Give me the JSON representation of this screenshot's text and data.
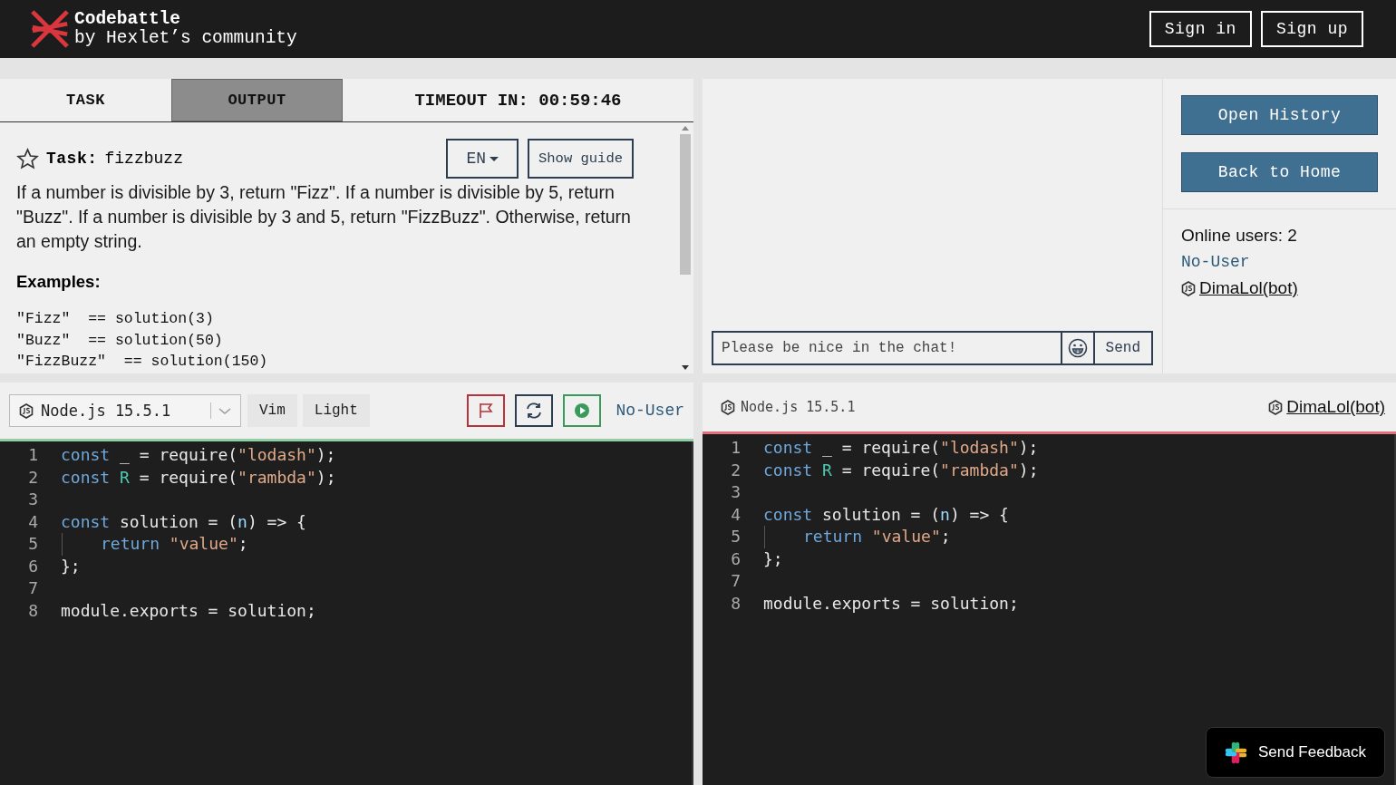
{
  "header": {
    "logo_title": "Codebattle",
    "logo_subtitle": "by Hexlet’s community",
    "buttons": [
      "Sign in",
      "Sign up"
    ]
  },
  "task_panel": {
    "tabs": [
      {
        "label": "TASK",
        "selected": true
      },
      {
        "label": "OUTPUT",
        "selected": false
      }
    ],
    "timeout": "TIMEOUT IN: 00:59:46",
    "starred": false,
    "task_label": "Task:",
    "task_name": "fizzbuzz",
    "language": "EN",
    "guide_button": "Show guide",
    "description": "If a number is divisible by 3, return \"Fizz\". If a number is divisible by 5, return \"Buzz\". If a number is divisible by 3 and 5, return \"FizzBuzz\". Otherwise, return an empty string.",
    "examples_heading": "Examples:",
    "examples": [
      "\"Fizz\"  == solution(3)",
      "\"Buzz\"  == solution(50)",
      "\"FizzBuzz\"  == solution(150)"
    ]
  },
  "chat": {
    "placeholder": "Please be nice in the chat!",
    "send": "Send"
  },
  "sidebar": {
    "buttons": [
      "Open History",
      "Back to Home"
    ],
    "online_users": "Online users: 2",
    "users": [
      {
        "name": "No-User",
        "kind": "user"
      },
      {
        "name": "DimaLol(bot)",
        "kind": "bot"
      }
    ]
  },
  "editors": [
    {
      "language": "Node.js 15.5.1",
      "kind": "own",
      "buttons": [
        "Vim",
        "Light"
      ],
      "player": "No-User",
      "color": "#8fd1a5",
      "lines": [
        {
          "number": "1",
          "tokens": [
            {
              "kind": "keyword",
              "text": "const "
            },
            {
              "kind": "plain",
              "text": "_ = require("
            },
            {
              "kind": "string",
              "text": "\"lodash\""
            },
            {
              "kind": "plain",
              "text": ");"
            }
          ]
        },
        {
          "number": "2",
          "tokens": [
            {
              "kind": "keyword",
              "text": "const "
            },
            {
              "kind": "var",
              "text": "R"
            },
            {
              "kind": "plain",
              "text": " = require("
            },
            {
              "kind": "string",
              "text": "\"rambda\""
            },
            {
              "kind": "plain",
              "text": ");"
            }
          ]
        },
        {
          "number": "3"
        },
        {
          "number": "4",
          "tokens": [
            {
              "kind": "keyword",
              "text": "const "
            },
            {
              "kind": "plain",
              "text": "solution = ("
            },
            {
              "kind": "param",
              "text": "n"
            },
            {
              "kind": "plain",
              "text": ") => {"
            }
          ]
        },
        {
          "number": "5",
          "indented": true,
          "tokens": [
            {
              "kind": "keyword",
              "text": "return "
            },
            {
              "kind": "string",
              "text": "\"value\""
            },
            {
              "kind": "plain",
              "text": ";"
            }
          ]
        },
        {
          "number": "6",
          "tokens": [
            {
              "kind": "plain",
              "text": "};"
            }
          ]
        },
        {
          "number": "7"
        },
        {
          "number": "8",
          "tokens": [
            {
              "kind": "plain",
              "text": "module.exports = solution;"
            }
          ]
        }
      ]
    },
    {
      "language": "Node.js 15.5.1",
      "kind": "opponent",
      "player": "DimaLol(bot)",
      "color": "#e0707a",
      "lines": [
        {
          "number": "1",
          "tokens": [
            {
              "kind": "keyword",
              "text": "const "
            },
            {
              "kind": "plain",
              "text": "_ = require("
            },
            {
              "kind": "string",
              "text": "\"lodash\""
            },
            {
              "kind": "plain",
              "text": ");"
            }
          ]
        },
        {
          "number": "2",
          "tokens": [
            {
              "kind": "keyword",
              "text": "const "
            },
            {
              "kind": "var",
              "text": "R"
            },
            {
              "kind": "plain",
              "text": " = require("
            },
            {
              "kind": "string",
              "text": "\"rambda\""
            },
            {
              "kind": "plain",
              "text": ");"
            }
          ]
        },
        {
          "number": "3"
        },
        {
          "number": "4",
          "tokens": [
            {
              "kind": "keyword",
              "text": "const "
            },
            {
              "kind": "plain",
              "text": "solution = ("
            },
            {
              "kind": "param",
              "text": "n"
            },
            {
              "kind": "plain",
              "text": ") => {"
            }
          ]
        },
        {
          "number": "5",
          "indented": true,
          "tokens": [
            {
              "kind": "keyword",
              "text": "return "
            },
            {
              "kind": "string",
              "text": "\"value\""
            },
            {
              "kind": "plain",
              "text": ";"
            }
          ]
        },
        {
          "number": "6",
          "tokens": [
            {
              "kind": "plain",
              "text": "};"
            }
          ]
        },
        {
          "number": "7"
        },
        {
          "number": "8",
          "tokens": [
            {
              "kind": "plain",
              "text": "module.exports = solution;"
            }
          ]
        }
      ]
    }
  ],
  "feedback": {
    "label": "Send Feedback"
  }
}
